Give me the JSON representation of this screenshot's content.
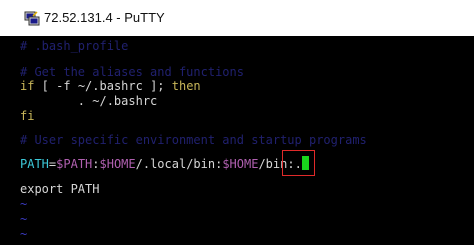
{
  "window": {
    "title": "72.52.131.4 - PuTTY",
    "icon": "putty-terminal-icon"
  },
  "terminal": {
    "line_get_aliases": "# .bash_profile",
    "line_comment_aliases": "# Get the aliases and functions",
    "line_if_1": "if",
    "line_if_2": " [ ",
    "line_if_3": "-f ~/.bashrc",
    "line_if_4": " ]; ",
    "line_if_5": "then",
    "line_source": "        . ~/.bashrc",
    "line_fi": "fi",
    "line_comment_env": "# User specific environment and startup programs",
    "path_var": "PATH",
    "path_eq": "=",
    "path_ref1": "$PATH",
    "path_colon1": ":",
    "path_ref2": "$HOME",
    "path_mid": "/.local/bin:",
    "path_ref3": "$HOME",
    "path_end": "/bin:.",
    "line_export": "export PATH",
    "tilde": "~"
  },
  "colors": {
    "comment": "#20206e",
    "keyword": "#c9b75a",
    "variable": "#b060b0",
    "path_name": "#3cc8d8",
    "cursor": "#19d61c",
    "highlight": "#e02a2a"
  }
}
